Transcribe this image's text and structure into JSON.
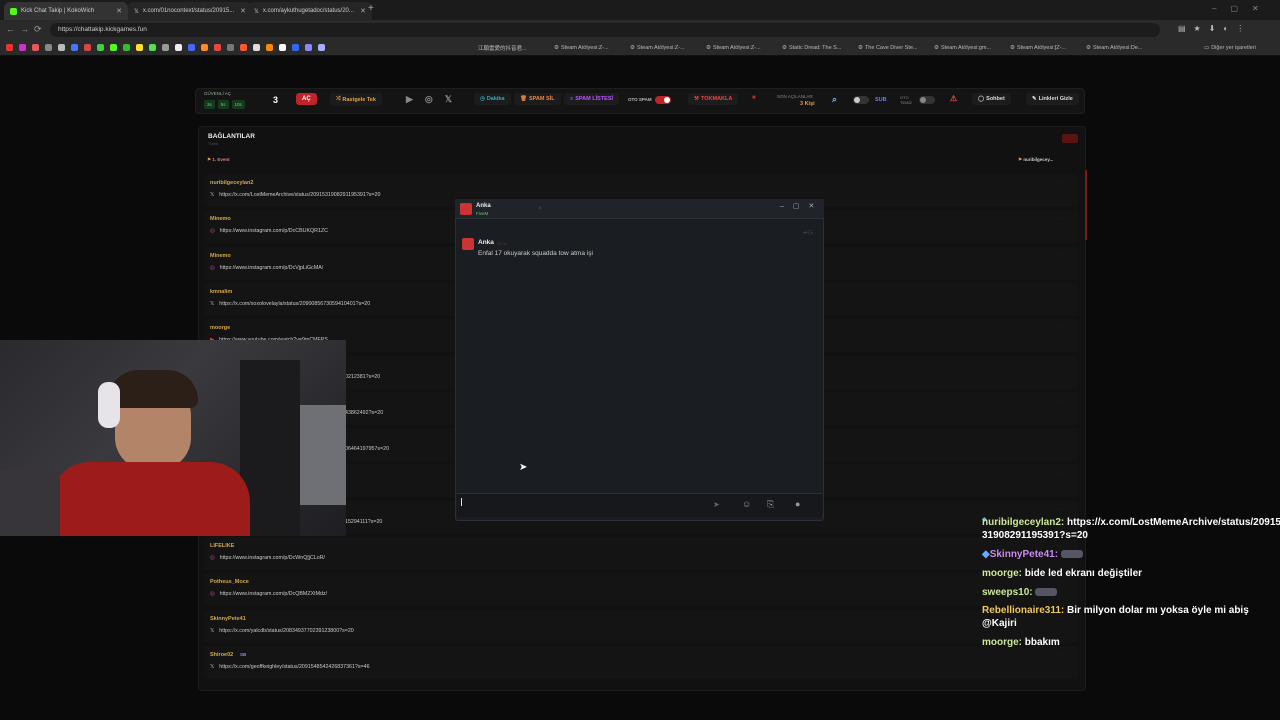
{
  "browser": {
    "tabs": [
      {
        "title": "Kick Chat Takip | KokoWich"
      },
      {
        "title": "x.com/01nocontext/status/20915..."
      },
      {
        "title": "x.com/aykuthugetadoc/status/20..."
      }
    ],
    "url": "https://chattakip.kickgames.fun",
    "bookmarks": [
      "江願雲愛的抖音君...",
      "Steam Atölyesi:Z-...",
      "Steam Atölyesi:Z-...",
      "Steam Atölyesi:Z-...",
      "Static Dread: The S...",
      "The Cave Diver Ste...",
      "Steam Atölyesi:gm...",
      "Steam Atölyesi:[Z-...",
      "Steam Atölyesi:De..."
    ],
    "other_bookmarks": "Diğer yer işaretleri"
  },
  "toolbar": {
    "guvenli_label": "GÜVENLİ AÇ",
    "guvenli_opts": [
      "3s",
      "5s",
      "10s"
    ],
    "count": "3",
    "ac": "AÇ",
    "rastgele": "Rastgele Tek",
    "dakika": "Dakika",
    "spam_sil": "SPAM SİL",
    "spam_listesi": "SPAM LİSTESİ",
    "oto_spam": "OTO SPAM",
    "tokmakla": "TOKMAKLA",
    "son_acilanlar_label": "SON AÇILANLAR",
    "son_acilanlar_value": "3 Kişi",
    "sub": "SUB",
    "oto_temiz": "OTO TEMİZ",
    "sohbet": "Sohbet",
    "linkleri_gizle": "Linkleri Gizle"
  },
  "connections": {
    "title": "BAĞLANTILAR",
    "subtitle": "Tümü",
    "filter_left": "1. Event",
    "filter_right": "nuribilgecey...",
    "rows": [
      {
        "user": "nuribilgeceylan2",
        "link": "https://x.com/LostMemeArchive/status/2091531908291195391?s=20",
        "icon": "x"
      },
      {
        "user": "Minemo",
        "link": "https://www.instagram.com/p/DcCBUKQR1ZC",
        "icon": "ig"
      },
      {
        "user": "Minemo",
        "link": "https://www.instagram.com/p/DcVjpLiGcMA/",
        "icon": "ig"
      },
      {
        "user": "kmnalim",
        "link": "https://x.com/xoxolovelayla/status/2090085673059410401?s=20",
        "icon": "x"
      },
      {
        "user": "moorge",
        "link": "https://www.youtube.com/watch?v=9mCMFPS",
        "icon": "yt"
      },
      {
        "user": "",
        "link": "0212381?s=20",
        "icon": ""
      },
      {
        "user": "",
        "link": "43862492?s=20",
        "icon": ""
      },
      {
        "user": "",
        "link": "06464197957s=20",
        "icon": ""
      },
      {
        "user": "",
        "link": "",
        "icon": ""
      },
      {
        "user": "",
        "link": "15294111?s=20",
        "icon": ""
      },
      {
        "user": "LIFELIKE",
        "link": "https://www.instagram.com/p/DcWnQ[jCLoR/",
        "icon": "ig"
      },
      {
        "user": "Potheus_Moce",
        "link": "https://www.instagram.com/p/DcQBMZXtMdz/",
        "icon": "ig"
      },
      {
        "user": "SkinnyPete41",
        "link": "https://x.com/yalcdb/status/2083493770239123800?s=20",
        "icon": "x"
      },
      {
        "user": "Shiroe02",
        "link": "https://x.com/geoffkeighley/status/2091548542426837361?s=46",
        "icon": "x",
        "badge": "SB"
      }
    ]
  },
  "modal": {
    "contact_name": "Anka",
    "contact_sub": "FiveM",
    "message_user": "Anka",
    "message_time": "21:04",
    "message_text": "Enfal 17 okuyarak squadda tow atma işi"
  },
  "chat_overlay": [
    {
      "user": "nuribilgeceylan2:",
      "text": "https://x.com/LostMemeArchive/status/20915",
      "cont": "31908291195391?s=20"
    },
    {
      "user": "SkinnyPete41:",
      "text": ""
    },
    {
      "user": "moorge:",
      "text": "bide led ekranı değiştiler"
    },
    {
      "user": "sweeps10:",
      "text": ""
    },
    {
      "user": "Rebellionaire311:",
      "text": "Bir milyon dolar mı yoksa öyle mi abiş",
      "cont": "@Kajiri"
    },
    {
      "user": "moorge:",
      "text": "bbakım"
    }
  ],
  "colors": {
    "accent_red": "#c0242a",
    "name_gold": "#d4a84a",
    "chat_green": "#cde89a"
  }
}
